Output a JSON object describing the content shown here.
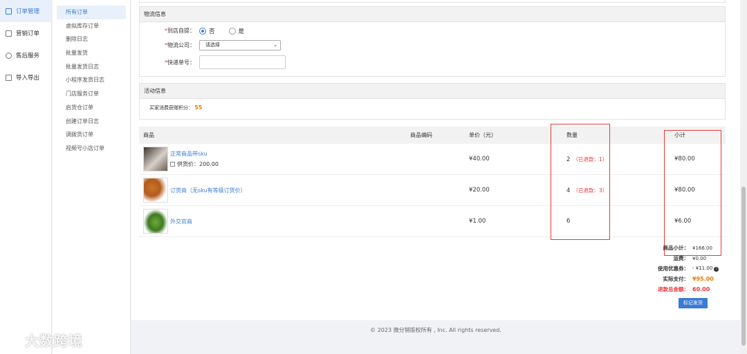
{
  "nav_primary": [
    {
      "label": "订单管理",
      "icon": "document-icon"
    },
    {
      "label": "营销订单",
      "icon": "document-icon"
    },
    {
      "label": "售后服务",
      "icon": "headset-icon"
    },
    {
      "label": "导入导出",
      "icon": "import-icon"
    }
  ],
  "nav_secondary": [
    "所有订单",
    "虚拟库存订单",
    "删除日志",
    "批量发货",
    "批量发货日志",
    "小程序发货日志",
    "门店服务订单",
    "启货仓订单",
    "创建订单日志",
    "调拨货订单",
    "视频号小店订单"
  ],
  "logistics": {
    "title": "物流信息",
    "pickup_label": "到店自提：",
    "pickup_no": "否",
    "pickup_yes": "是",
    "company_label": "物流公司：",
    "company_value": "请选择",
    "tracking_label": "快递单号：",
    "tracking_value": ""
  },
  "activity": {
    "title": "活动信息",
    "points_label": "买家消费获赠积分：",
    "points_value": "55"
  },
  "products": {
    "headers": {
      "product": "商品",
      "code": "商品编码",
      "price": "单价（元）",
      "qty": "数量",
      "subtotal": "小计"
    },
    "rows": [
      {
        "name": "正常商品带sku",
        "sub": "供货价：200.00",
        "price": "¥40.00",
        "qty": "2",
        "refund": "（已退款：1）",
        "subtotal": "¥80.00"
      },
      {
        "name": "订货商（无sku有等级订货价）",
        "sub": "",
        "price": "¥20.00",
        "qty": "4",
        "refund": "（已退款：3）",
        "subtotal": "¥80.00"
      },
      {
        "name": "外交官商",
        "sub": "",
        "price": "¥1.00",
        "qty": "6",
        "refund": "",
        "subtotal": "¥6.00"
      }
    ]
  },
  "summary": {
    "goods_total_label": "商品小计：",
    "goods_total": "¥166.00",
    "freight_label": "运费：",
    "freight": "¥0.00",
    "coupon_label": "使用优惠券：",
    "coupon": "- ¥11.00",
    "paid_label": "实际支付：",
    "paid": "¥95.00",
    "refund_label": "退款总金额：",
    "refund": "60.00",
    "ship_button": "标记发货"
  },
  "footer": "© 2023 微分销版权所有 , Inc. All rights reserved.",
  "watermark": "大数跨境",
  "colors": {
    "accent": "#3a7bd5",
    "highlight_box": "#e53935",
    "points": "#e8790b",
    "refund": "#e33333"
  }
}
